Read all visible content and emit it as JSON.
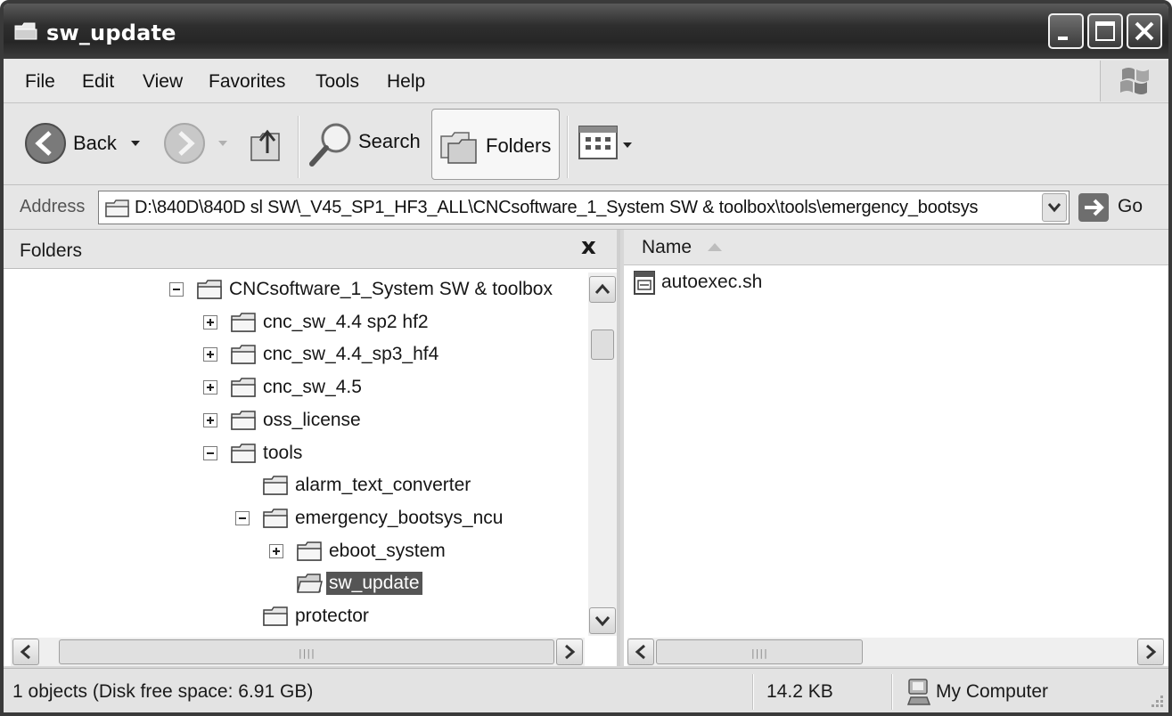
{
  "window": {
    "title": "sw_update"
  },
  "menu": [
    "File",
    "Edit",
    "View",
    "Favorites",
    "Tools",
    "Help"
  ],
  "toolbar": {
    "back": "Back",
    "search": "Search",
    "folders": "Folders"
  },
  "address": {
    "label": "Address",
    "path": "D:\\840D\\840D sl SW\\_V45_SP1_HF3_ALL\\CNCsoftware_1_System SW & toolbox\\tools\\emergency_bootsys",
    "go": "Go"
  },
  "folders_pane": {
    "title": "Folders",
    "close": "x",
    "items": [
      {
        "label": "CNCsoftware_1_System SW & toolbox",
        "toggle": "minus"
      },
      {
        "label": "cnc_sw_4.4 sp2 hf2",
        "toggle": "plus"
      },
      {
        "label": "cnc_sw_4.4_sp3_hf4",
        "toggle": "plus"
      },
      {
        "label": "cnc_sw_4.5",
        "toggle": "plus"
      },
      {
        "label": "oss_license",
        "toggle": "plus"
      },
      {
        "label": "tools",
        "toggle": "minus"
      },
      {
        "label": "alarm_text_converter",
        "toggle": "none"
      },
      {
        "label": "emergency_bootsys_ncu",
        "toggle": "minus"
      },
      {
        "label": "eboot_system",
        "toggle": "plus"
      },
      {
        "label": "sw_update",
        "toggle": "none",
        "selected": true
      },
      {
        "label": "protector",
        "toggle": "none"
      }
    ]
  },
  "files_pane": {
    "column_name": "Name",
    "files": [
      {
        "name": "autoexec.sh",
        "icon": "script-file-icon"
      }
    ]
  },
  "status": {
    "objects": "1 objects (Disk free space: 6.91 GB)",
    "size": "14.2 KB",
    "location": "My Computer"
  }
}
